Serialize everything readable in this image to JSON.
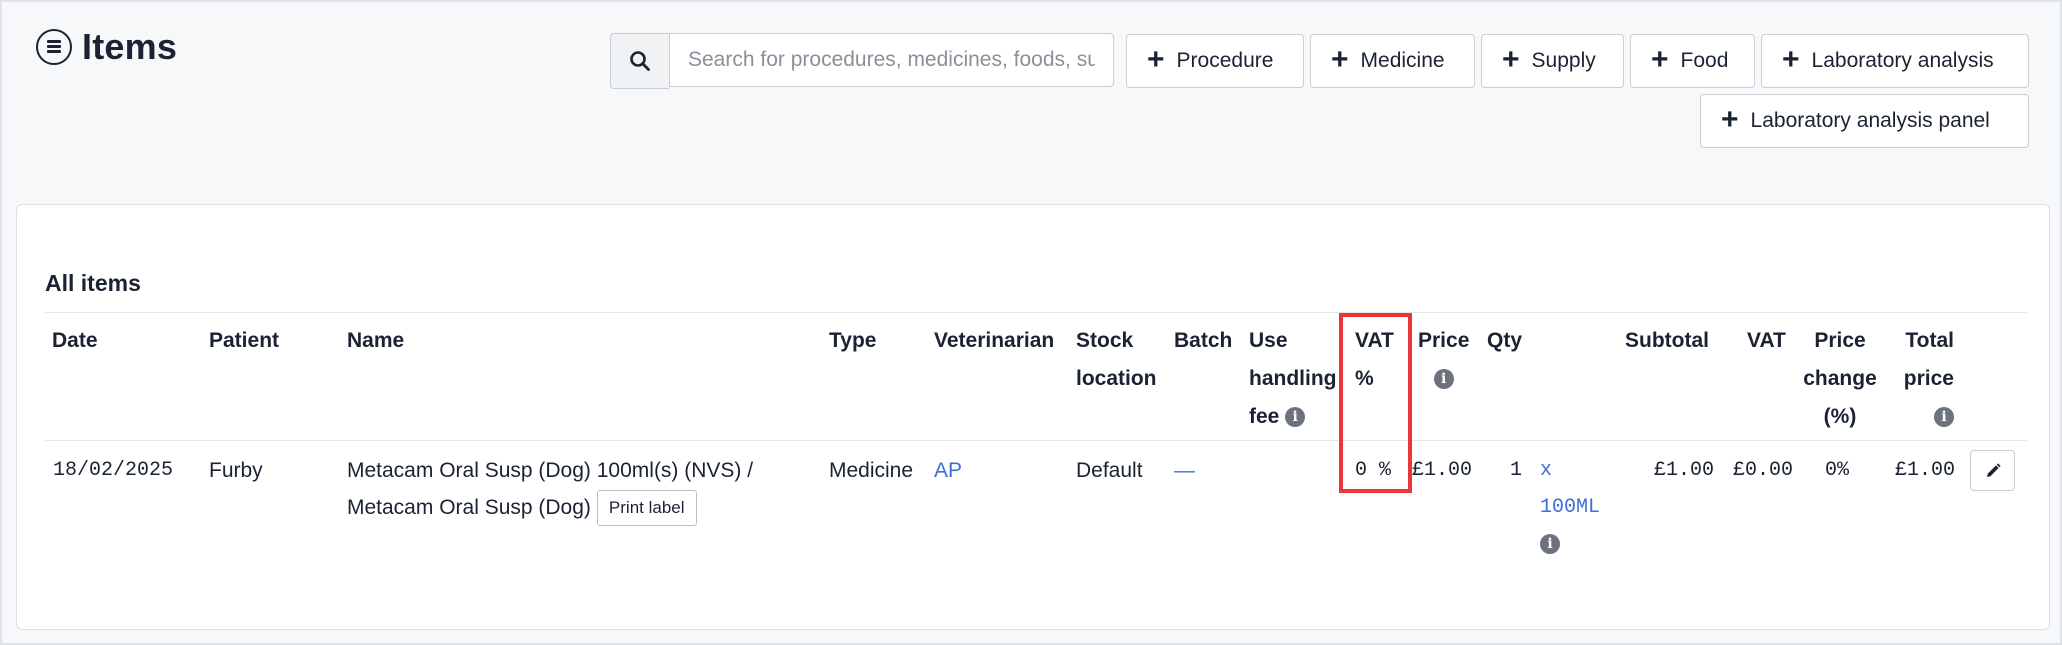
{
  "header": {
    "title": "Items",
    "title_icon": "list-circle-icon"
  },
  "search": {
    "placeholder": "Search for procedures, medicines, foods, supplies..."
  },
  "add_buttons": {
    "procedure": "Procedure",
    "medicine": "Medicine",
    "supply": "Supply",
    "food": "Food",
    "laboratory_analysis": "Laboratory analysis",
    "laboratory_analysis_panel": "Laboratory analysis panel"
  },
  "table": {
    "title": "All items",
    "headers": {
      "date": "Date",
      "patient": "Patient",
      "name": "Name",
      "type": "Type",
      "veterinarian": "Veterinarian",
      "stock_location_1": "Stock",
      "stock_location_2": "location",
      "batch": "Batch",
      "handling_1": "Use",
      "handling_2": "handling",
      "handling_3": "fee",
      "vat_pct_1": "VAT",
      "vat_pct_2": "%",
      "price": "Price",
      "qty": "Qty",
      "subtotal": "Subtotal",
      "vat": "VAT",
      "price_change_1": "Price",
      "price_change_2": "change",
      "price_change_3": "(%)",
      "total_1": "Total",
      "total_2": "price"
    },
    "rows": [
      {
        "date": "18/02/2025",
        "patient": "Furby",
        "name_line1": "Metacam Oral Susp (Dog) 100ml(s) (NVS) /",
        "name_line2": "Metacam Oral Susp (Dog)",
        "print_label": "Print label",
        "type": "Medicine",
        "veterinarian": "AP",
        "stock_location": "Default",
        "batch": "—",
        "vat_pct": "0 %",
        "price": "£1.00",
        "qty": "1",
        "unit_1": "x",
        "unit_2": "100ML",
        "subtotal": "£1.00",
        "vat": "£0.00",
        "price_change": "0%",
        "total_price": "£1.00"
      }
    ]
  },
  "colors": {
    "accent_link": "#3d6fd6",
    "highlight": "#e8383b",
    "text": "#1b2333"
  }
}
